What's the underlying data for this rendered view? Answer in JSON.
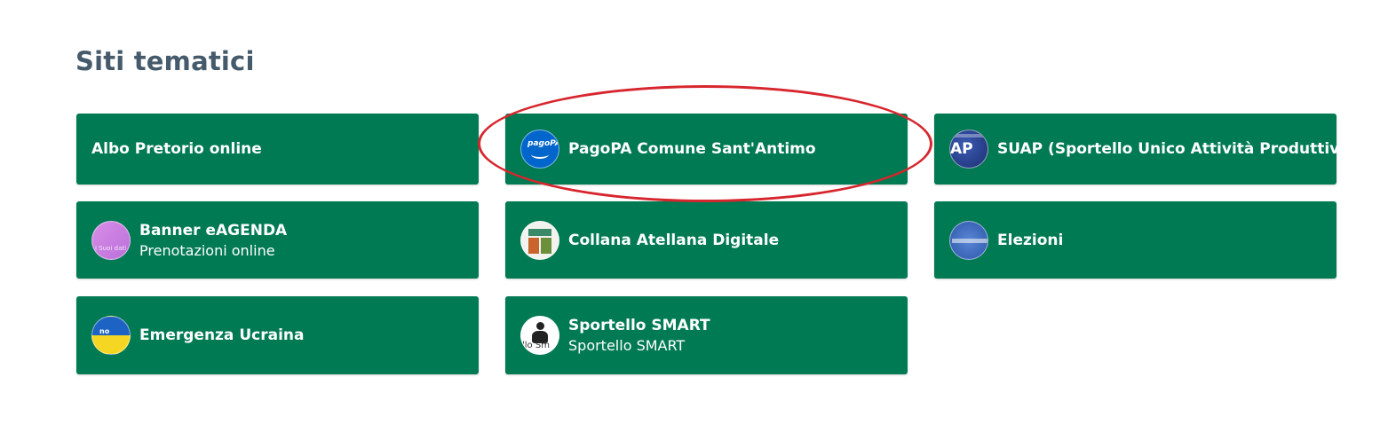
{
  "section": {
    "title": "Siti tematici"
  },
  "cards": [
    {
      "title": "Albo Pretorio online",
      "subtitle": "",
      "icon": ""
    },
    {
      "title": "PagoPA Comune Sant'Antimo",
      "subtitle": "",
      "icon": "pagopa-logo-icon"
    },
    {
      "title": "SUAP (Sportello Unico Attività Produttive)",
      "subtitle": "",
      "icon": "suap-logo-icon"
    },
    {
      "title": "Banner eAGENDA",
      "subtitle": "Prenotazioni online",
      "icon": "eagenda-logo-icon"
    },
    {
      "title": "Collana Atellana Digitale",
      "subtitle": "",
      "icon": "collana-logo-icon"
    },
    {
      "title": "Elezioni",
      "subtitle": "",
      "icon": "elezioni-logo-icon"
    },
    {
      "title": "Emergenza Ucraina",
      "subtitle": "",
      "icon": "ucraina-flag-icon"
    },
    {
      "title": "Sportello SMART",
      "subtitle": "Sportello SMART",
      "icon": "sportello-smart-logo-icon"
    }
  ],
  "avatar_text": {
    "pagopa": "pagoPA",
    "suap": "AP",
    "agenda": "I Suoi dati",
    "ucraina": "no",
    "smart": "llo Sm"
  },
  "colors": {
    "card_background": "#007a52",
    "title_color": "#455a6b",
    "highlight": "#d7262e"
  }
}
